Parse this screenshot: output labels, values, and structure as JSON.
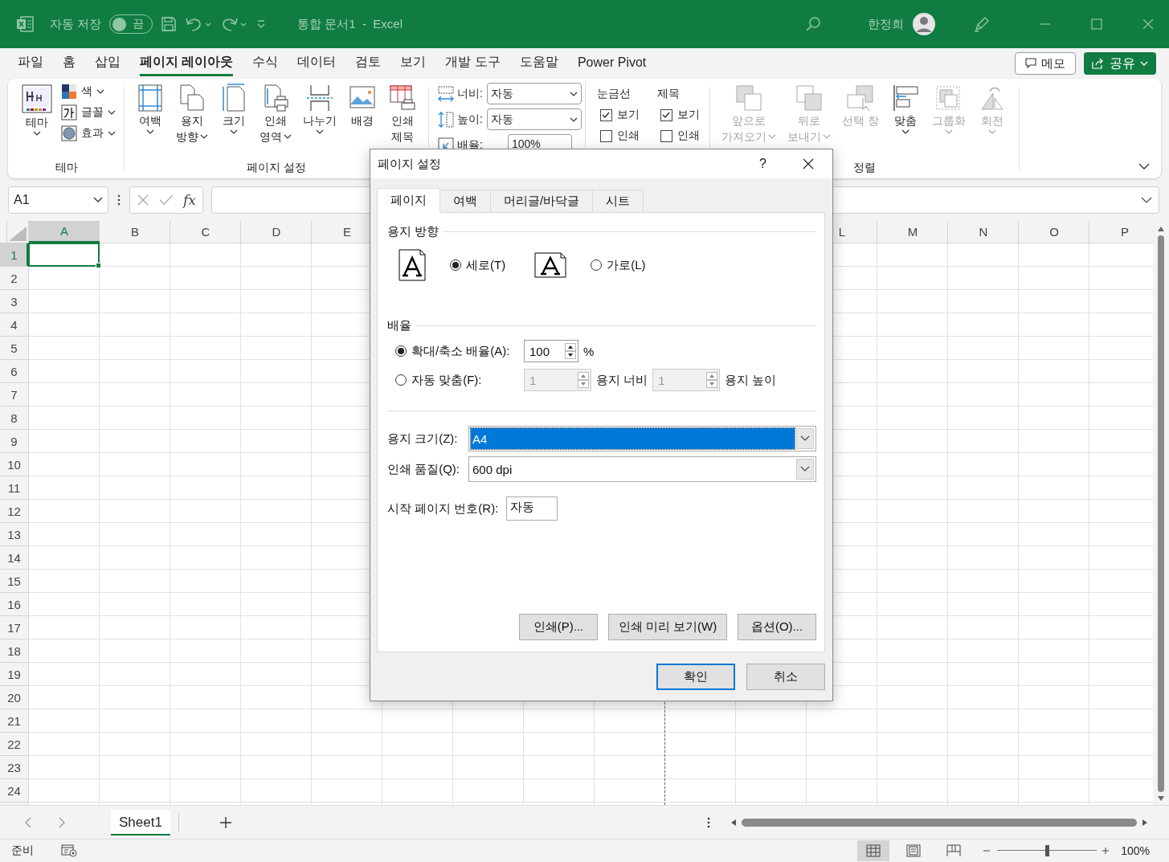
{
  "title_bar": {
    "autosave_label": "자동 저장",
    "autosave": {
      "on": false,
      "label": "끔"
    },
    "document_title": "통합 문서1  -  Excel",
    "user_name": "한정희"
  },
  "menu_tabs": [
    {
      "label": "파일",
      "selected": false
    },
    {
      "label": "홈",
      "selected": false
    },
    {
      "label": "삽입",
      "selected": false
    },
    {
      "label": "페이지 레이아웃",
      "selected": true
    },
    {
      "label": "수식",
      "selected": false
    },
    {
      "label": "데이터",
      "selected": false
    },
    {
      "label": "검토",
      "selected": false
    },
    {
      "label": "보기",
      "selected": false
    },
    {
      "label": "개발 도구",
      "selected": false
    },
    {
      "label": "도움말",
      "selected": false
    },
    {
      "label": "Power Pivot",
      "selected": false
    }
  ],
  "menu_buttons": {
    "memo": "메모",
    "share": "공유"
  },
  "ribbon": {
    "theme_group": {
      "label": "테마",
      "big": {
        "label": "테마"
      },
      "small": [
        {
          "kind": "colors",
          "label": "색"
        },
        {
          "kind": "fonts",
          "label": "글꼴"
        },
        {
          "kind": "effects",
          "label": "효과"
        }
      ]
    },
    "page_setup_group": {
      "label": "페이지 설정",
      "buttons": [
        {
          "kind": "margins",
          "lines": [
            "여백"
          ],
          "dropdown": true
        },
        {
          "kind": "orientation",
          "lines": [
            "용지",
            "방향"
          ],
          "dropdown": true
        },
        {
          "kind": "size",
          "lines": [
            "크기"
          ],
          "dropdown": true
        },
        {
          "kind": "print_area",
          "lines": [
            "인쇄",
            "영역"
          ],
          "dropdown": true
        },
        {
          "kind": "breaks",
          "lines": [
            "나누기"
          ],
          "dropdown": true
        },
        {
          "kind": "background",
          "lines": [
            "배경"
          ],
          "dropdown": false
        },
        {
          "kind": "print_titles",
          "lines": [
            "인쇄",
            "제목"
          ],
          "dropdown": false
        }
      ]
    },
    "scale_group": {
      "width": {
        "label": "너비:",
        "value": "자동"
      },
      "height": {
        "label": "높이:",
        "value": "자동"
      },
      "scale": {
        "label": "배율:",
        "value": "100%"
      }
    },
    "sheet_options": [
      {
        "title": "눈금선",
        "view": {
          "label": "보기",
          "checked": true
        },
        "print": {
          "label": "인쇄",
          "checked": false
        }
      },
      {
        "title": "제목",
        "view": {
          "label": "보기",
          "checked": true
        },
        "print": {
          "label": "인쇄",
          "checked": false
        }
      }
    ],
    "arrange_group": {
      "label": "정렬",
      "buttons": [
        {
          "kind": "bring_forward",
          "lines": [
            "앞으로",
            "가져오기"
          ],
          "dropdown": true,
          "disabled": true
        },
        {
          "kind": "send_backward",
          "lines": [
            "뒤로",
            "보내기"
          ],
          "dropdown": true,
          "disabled": true
        },
        {
          "kind": "selection_pane",
          "lines": [
            "선택 창"
          ],
          "dropdown": false,
          "disabled": true
        },
        {
          "kind": "align",
          "lines": [
            "맞춤"
          ],
          "dropdown": true,
          "disabled": false
        },
        {
          "kind": "group",
          "lines": [
            "그룹화"
          ],
          "dropdown": true,
          "disabled": true
        },
        {
          "kind": "rotate",
          "lines": [
            "회전"
          ],
          "dropdown": true,
          "disabled": true
        }
      ]
    }
  },
  "formula_bar": {
    "name_box": "A1",
    "fx": "fx"
  },
  "grid": {
    "columns": [
      {
        "label": "A",
        "selected": true
      },
      {
        "label": "B",
        "selected": false
      },
      {
        "label": "C",
        "selected": false
      },
      {
        "label": "D",
        "selected": false
      },
      {
        "label": "E",
        "selected": false
      },
      {
        "label": "L",
        "selected": false
      },
      {
        "label": "M",
        "selected": false
      },
      {
        "label": "N",
        "selected": false
      },
      {
        "label": "O",
        "selected": false
      },
      {
        "label": "P",
        "selected": false
      }
    ],
    "rows": [
      {
        "label": "1",
        "selected": true
      },
      {
        "label": "2",
        "selected": false
      },
      {
        "label": "3",
        "selected": false
      },
      {
        "label": "4",
        "selected": false
      },
      {
        "label": "5",
        "selected": false
      },
      {
        "label": "6",
        "selected": false
      },
      {
        "label": "7",
        "selected": false
      },
      {
        "label": "8",
        "selected": false
      },
      {
        "label": "9",
        "selected": false
      },
      {
        "label": "10",
        "selected": false
      },
      {
        "label": "11",
        "selected": false
      },
      {
        "label": "12",
        "selected": false
      },
      {
        "label": "13",
        "selected": false
      },
      {
        "label": "14",
        "selected": false
      },
      {
        "label": "15",
        "selected": false
      },
      {
        "label": "16",
        "selected": false
      },
      {
        "label": "17",
        "selected": false
      },
      {
        "label": "18",
        "selected": false
      },
      {
        "label": "19",
        "selected": false
      },
      {
        "label": "20",
        "selected": false
      },
      {
        "label": "21",
        "selected": false
      },
      {
        "label": "22",
        "selected": false
      },
      {
        "label": "23",
        "selected": false
      },
      {
        "label": "24",
        "selected": false
      }
    ]
  },
  "sheet_tabs": [
    {
      "label": "Sheet1",
      "selected": true
    }
  ],
  "status_bar": {
    "status": "준비",
    "views": [
      {
        "kind": "normal",
        "selected": true
      },
      {
        "kind": "page_layout",
        "selected": false
      },
      {
        "kind": "page_break",
        "selected": false
      }
    ],
    "zoom": {
      "level": 0.5,
      "label": "100%"
    }
  },
  "dialog": {
    "title": "페이지 설정",
    "help": "?",
    "tabs": [
      {
        "label": "페이지",
        "selected": true
      },
      {
        "label": "여백",
        "selected": false
      },
      {
        "label": "머리글/바닥글",
        "selected": false
      },
      {
        "label": "시트",
        "selected": false
      }
    ],
    "orientation": {
      "heading": "용지 방향",
      "options": [
        {
          "kind": "portrait",
          "label": "세로(T)",
          "selected": true
        },
        {
          "kind": "landscape",
          "label": "가로(L)",
          "selected": false
        }
      ]
    },
    "scaling": {
      "heading": "배율",
      "adjust": {
        "label": "확대/축소 배율(A):",
        "selected": true,
        "value": "100",
        "unit": "%"
      },
      "fit": {
        "label": "자동 맞춤(F):",
        "selected": false,
        "wide": "1",
        "wide_label": "용지 너비",
        "tall": "1",
        "tall_label": "용지 높이"
      }
    },
    "paper_size": {
      "label": "용지 크기(Z):",
      "value": "A4"
    },
    "print_quality": {
      "label": "인쇄 품질(Q):",
      "value": "600 dpi"
    },
    "first_page": {
      "label": "시작 페이지 번호(R):",
      "value": "자동"
    },
    "panel_buttons": [
      "인쇄(P)...",
      "인쇄 미리 보기(W)",
      "옵션(O)..."
    ],
    "ok": "확인",
    "cancel": "취소"
  }
}
